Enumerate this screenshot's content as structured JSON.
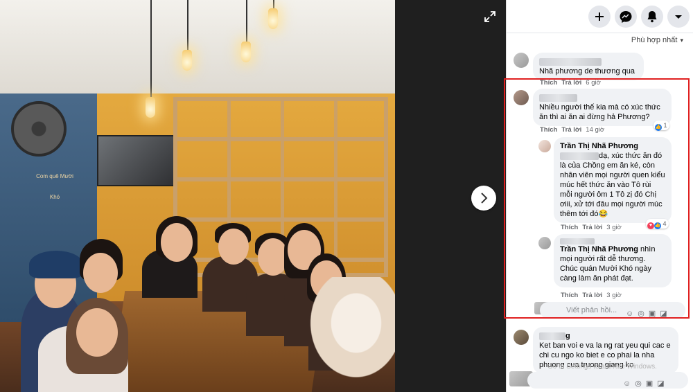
{
  "viewer": {
    "expand_icon": "expand-icon",
    "next_icon": "chevron-right-icon",
    "photo_caption_logo": "Com quê Mười Khó"
  },
  "topbar": {
    "buttons": [
      "+",
      "m",
      "🔔",
      "▾"
    ]
  },
  "sort": {
    "label": "Phù hợp nhất",
    "chevron": "▾"
  },
  "comments": [
    {
      "text": "Nhã phương de thương qua",
      "actions": {
        "like": "Thích",
        "reply": "Trả lời",
        "time": "6 giờ"
      }
    },
    {
      "text": "Nhiều người thế kia mà có xúc thức ăn thì ai ăn ai đừng hả Phương?",
      "actions": {
        "like": "Thích",
        "reply": "Trả lời",
        "time": "14 giờ"
      },
      "reactions": "1"
    },
    {
      "author": "Trần Thị Nhã Phương",
      "text": "dạ, xúc thức ăn đó là của Chồng em ăn ké, còn nhân viên mọi người quen kiểu múc hết thức ăn vào Tô rùi mỗi người ôm 1 Tô zị đó Chị ơiii, xử tới đâu mọi người múc thêm tới đó😂",
      "actions": {
        "like": "Thích",
        "reply": "Trả lời",
        "time": "3 giờ"
      },
      "reactions": "4"
    },
    {
      "author": "Trần Thị Nhã Phương",
      "text": "nhìn mọi người rất dễ thương. Chúc quán Mười Khó ngày càng làm ăn phát đạt.",
      "actions": {
        "like": "Thích",
        "reply": "Trả lời",
        "time": "3 giờ"
      }
    },
    {
      "author_suffix": "g",
      "text": "Ket ban voi e va la ng rat yeu qui cac e chi cu ngo ko biet e co phai la nha phuong cua truong giang ko"
    }
  ],
  "reply_box": {
    "placeholder": "Viết phản hồi..."
  },
  "watermark": "Go to Settings to activate Windows."
}
